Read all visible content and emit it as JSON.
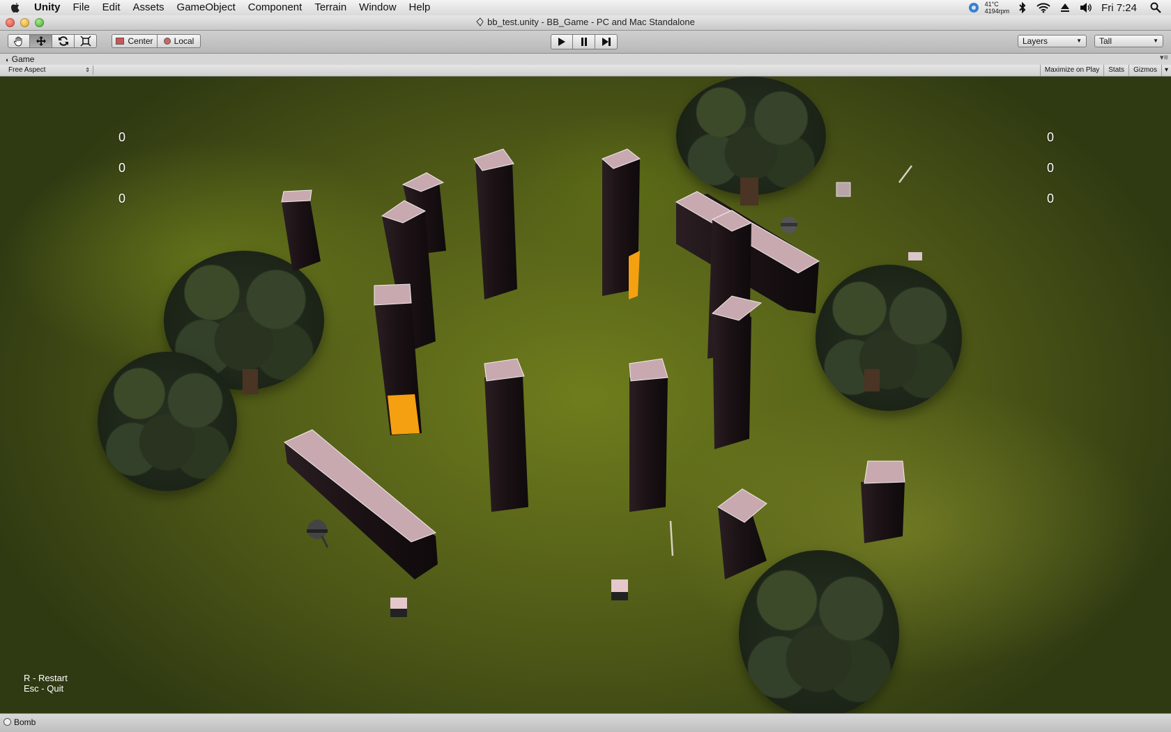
{
  "menubar": {
    "app": "Unity",
    "items": [
      "File",
      "Edit",
      "Assets",
      "GameObject",
      "Component",
      "Terrain",
      "Window",
      "Help"
    ],
    "status": {
      "temp": "41°C",
      "rpm": "4194rpm",
      "clock": "Fri 7:24"
    }
  },
  "window": {
    "title": "bb_test.unity - BB_Game - PC and Mac Standalone"
  },
  "toolbar": {
    "pivot": "Center",
    "space": "Local",
    "layers": "Layers",
    "layout": "Tall"
  },
  "game_panel": {
    "tab": "Game",
    "aspect": "Free Aspect",
    "maximize": "Maximize on Play",
    "stats": "Stats",
    "gizmos": "Gizmos"
  },
  "hud": {
    "left_scores": [
      "0",
      "0",
      "0"
    ],
    "right_scores": [
      "0",
      "0",
      "0"
    ],
    "restart": "R - Restart",
    "quit": "Esc - Quit"
  },
  "statusbar": {
    "message": "Bomb"
  },
  "colors": {
    "orange_block": "#f5a010",
    "pillar": "#1d1416",
    "pillar_top": "#c9a9b0"
  }
}
